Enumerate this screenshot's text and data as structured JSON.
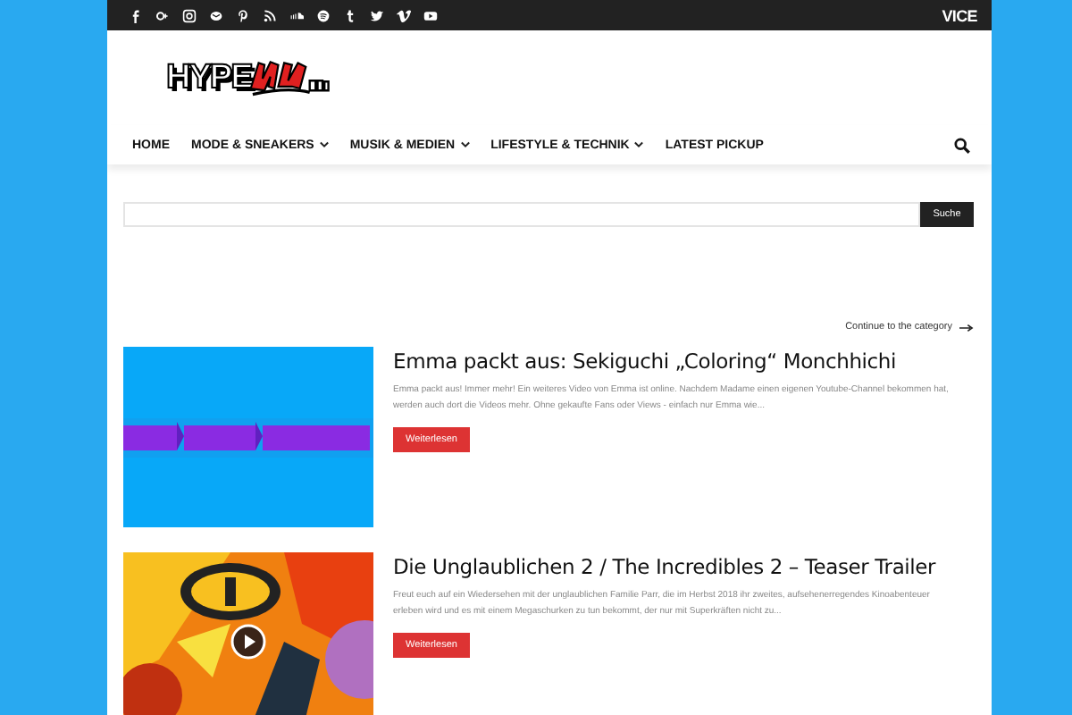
{
  "top_bar": {
    "social": [
      {
        "kind": "facebook"
      },
      {
        "kind": "googleplus"
      },
      {
        "kind": "instagram"
      },
      {
        "kind": "mail"
      },
      {
        "kind": "pinterest"
      },
      {
        "kind": "rss"
      },
      {
        "kind": "soundcloud"
      },
      {
        "kind": "spotify"
      },
      {
        "kind": "tumblr"
      },
      {
        "kind": "twitter"
      },
      {
        "kind": "vimeo"
      },
      {
        "kind": "youtube"
      }
    ],
    "partner": "VICE"
  },
  "logo": {
    "text": "HYPE"
  },
  "nav": {
    "items": [
      {
        "label": "HOME",
        "dropdown": false
      },
      {
        "label": "MODE & SNEAKERS",
        "dropdown": true
      },
      {
        "label": "MUSIK & MEDIEN",
        "dropdown": true
      },
      {
        "label": "LIFESTYLE & TECHNIK",
        "dropdown": true
      },
      {
        "label": "LATEST PICKUP",
        "dropdown": false
      }
    ]
  },
  "search": {
    "button": "Suche"
  },
  "continue_link": "Continue to the category",
  "articles": [
    {
      "title": "Emma packt aus: Sekiguchi „Coloring“ Monchhichi",
      "excerpt": "Emma packt aus! Immer mehr! Ein weiteres Video von Emma ist online. Nachdem Madame einen eigenen Youtube-Channel bekommen hat, werden auch dort die Videos mehr. Ohne gekaufte Fans oder Views - einfach nur Emma wie...",
      "button": "Weiterlesen",
      "kind": "flat",
      "video": false
    },
    {
      "title": "Die Unglaublichen 2 / The Incredibles 2 – Teaser Trailer",
      "excerpt": "Freut euch auf ein Wiedersehen mit der unglaublichen Familie Parr, die im Herbst 2018 ihr zweites, aufsehenerregendes Kinoabenteuer erleben wird und es mit einem Megaschurken zu tun bekommt, der nur mit Superkräften nicht zu...",
      "button": "Weiterlesen",
      "kind": "poster",
      "video": true
    }
  ]
}
